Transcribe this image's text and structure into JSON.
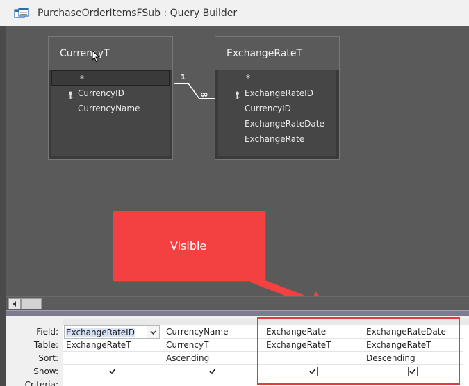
{
  "window": {
    "title": "PurchaseOrderItemsFSub : Query Builder",
    "icon": "query-builder-icon"
  },
  "tables": [
    {
      "name": "CurrencyT",
      "fields": [
        {
          "label": "*",
          "is_key": false
        },
        {
          "label": "CurrencyID",
          "is_key": true
        },
        {
          "label": "CurrencyName",
          "is_key": false
        }
      ]
    },
    {
      "name": "ExchangeRateT",
      "fields": [
        {
          "label": "*",
          "is_key": false
        },
        {
          "label": "ExchangeRateID",
          "is_key": true
        },
        {
          "label": "CurrencyID",
          "is_key": false
        },
        {
          "label": "ExchangeRateDate",
          "is_key": false
        },
        {
          "label": "ExchangeRate",
          "is_key": false
        }
      ]
    }
  ],
  "relationship": {
    "one_label": "1",
    "many_label": "∞"
  },
  "callout": {
    "label": "Visible",
    "color": "#f34141"
  },
  "grid": {
    "row_labels": [
      "Field:",
      "Table:",
      "Sort:",
      "Show:",
      "Criteria:"
    ],
    "columns": [
      {
        "field": "ExchangeRateID",
        "table": "ExchangeRateT",
        "sort": "",
        "show": true
      },
      {
        "field": "CurrencyName",
        "table": "CurrencyT",
        "sort": "Ascending",
        "show": true
      },
      {
        "field": "ExchangeRate",
        "table": "ExchangeRateT",
        "sort": "",
        "show": true
      },
      {
        "field": "ExchangeRateDate",
        "table": "ExchangeRateT",
        "sort": "Descending",
        "show": true
      }
    ]
  },
  "colors": {
    "highlight": "#e53a3a",
    "splitter": "#7d7c8e",
    "design_bg": "#5a5a5a"
  }
}
